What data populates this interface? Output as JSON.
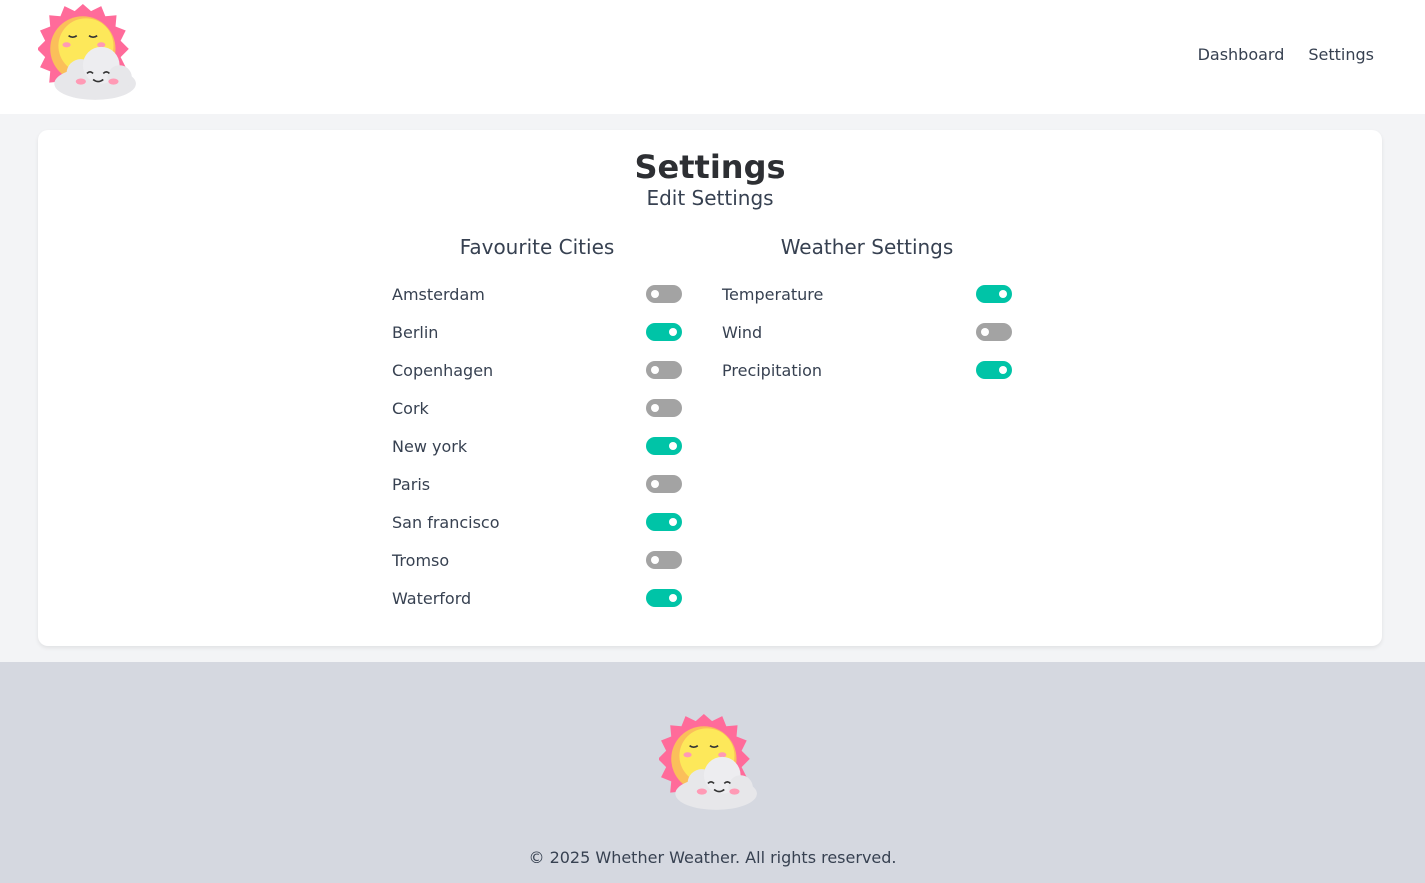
{
  "brand": {
    "logo_text": "Whether Weather"
  },
  "nav": {
    "dashboard": "Dashboard",
    "settings": "Settings"
  },
  "page": {
    "title": "Settings",
    "subtitle": "Edit Settings"
  },
  "cities": {
    "heading": "Favourite Cities",
    "items": [
      {
        "label": "Amsterdam",
        "on": false
      },
      {
        "label": "Berlin",
        "on": true
      },
      {
        "label": "Copenhagen",
        "on": false
      },
      {
        "label": "Cork",
        "on": false
      },
      {
        "label": "New york",
        "on": true
      },
      {
        "label": "Paris",
        "on": false
      },
      {
        "label": "San francisco",
        "on": true
      },
      {
        "label": "Tromso",
        "on": false
      },
      {
        "label": "Waterford",
        "on": true
      }
    ]
  },
  "weather": {
    "heading": "Weather Settings",
    "items": [
      {
        "label": "Temperature",
        "on": true
      },
      {
        "label": "Wind",
        "on": false
      },
      {
        "label": "Precipitation",
        "on": true
      }
    ]
  },
  "footer": {
    "copyright": "© 2025 Whether Weather. All rights reserved."
  },
  "colors": {
    "toggle_on": "#00c4a7",
    "toggle_off": "#a3a3a3",
    "footer_bg": "#d5d8e0"
  }
}
